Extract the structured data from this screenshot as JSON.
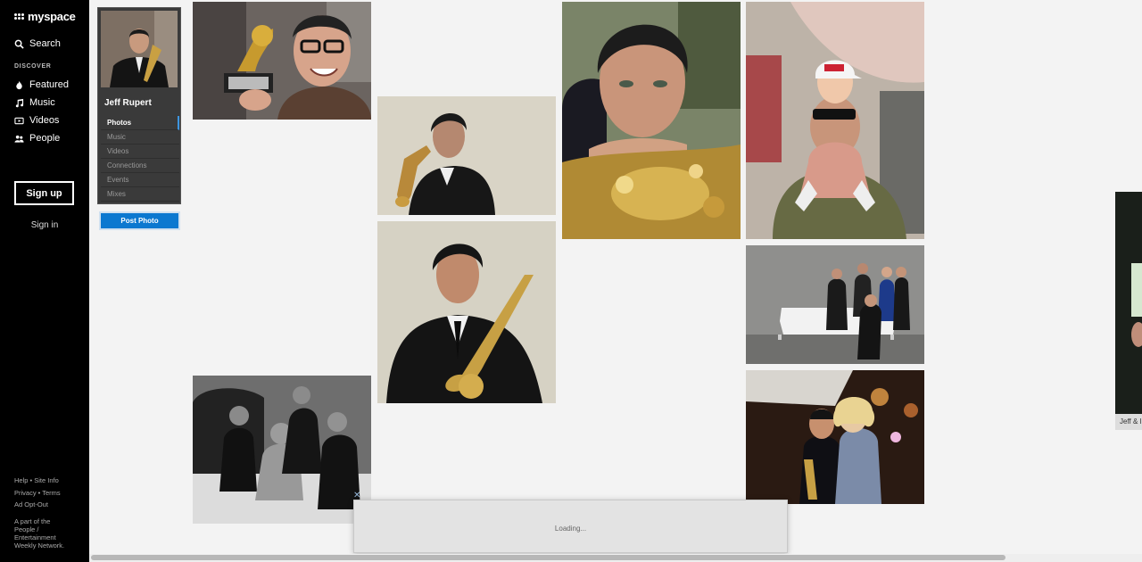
{
  "nav": {
    "logo": "myspace",
    "search": "Search",
    "section": "DISCOVER",
    "items": [
      {
        "label": "Featured",
        "icon": "flame-icon"
      },
      {
        "label": "Music",
        "icon": "music-note-icon"
      },
      {
        "label": "Videos",
        "icon": "video-icon"
      },
      {
        "label": "People",
        "icon": "people-icon"
      }
    ],
    "signup": "Sign up",
    "signin": "Sign in",
    "footer": {
      "help": "Help",
      "site_info": "Site Info",
      "privacy": "Privacy",
      "terms": "Terms",
      "ad_opt_out": "Ad Opt-Out",
      "network": "A part of the People / Entertainment Weekly Network."
    }
  },
  "profile": {
    "name": "Jeff Rupert",
    "menu": [
      "Photos",
      "Music",
      "Videos",
      "Connections",
      "Events",
      "Mixes"
    ],
    "active": "Photos",
    "post_button": "Post Photo"
  },
  "caption": "Jeff & I",
  "loading": "Loading...",
  "colors": {
    "accent": "#0b78d0",
    "nav_bg": "#000000",
    "page_bg": "#f3f3f3"
  }
}
